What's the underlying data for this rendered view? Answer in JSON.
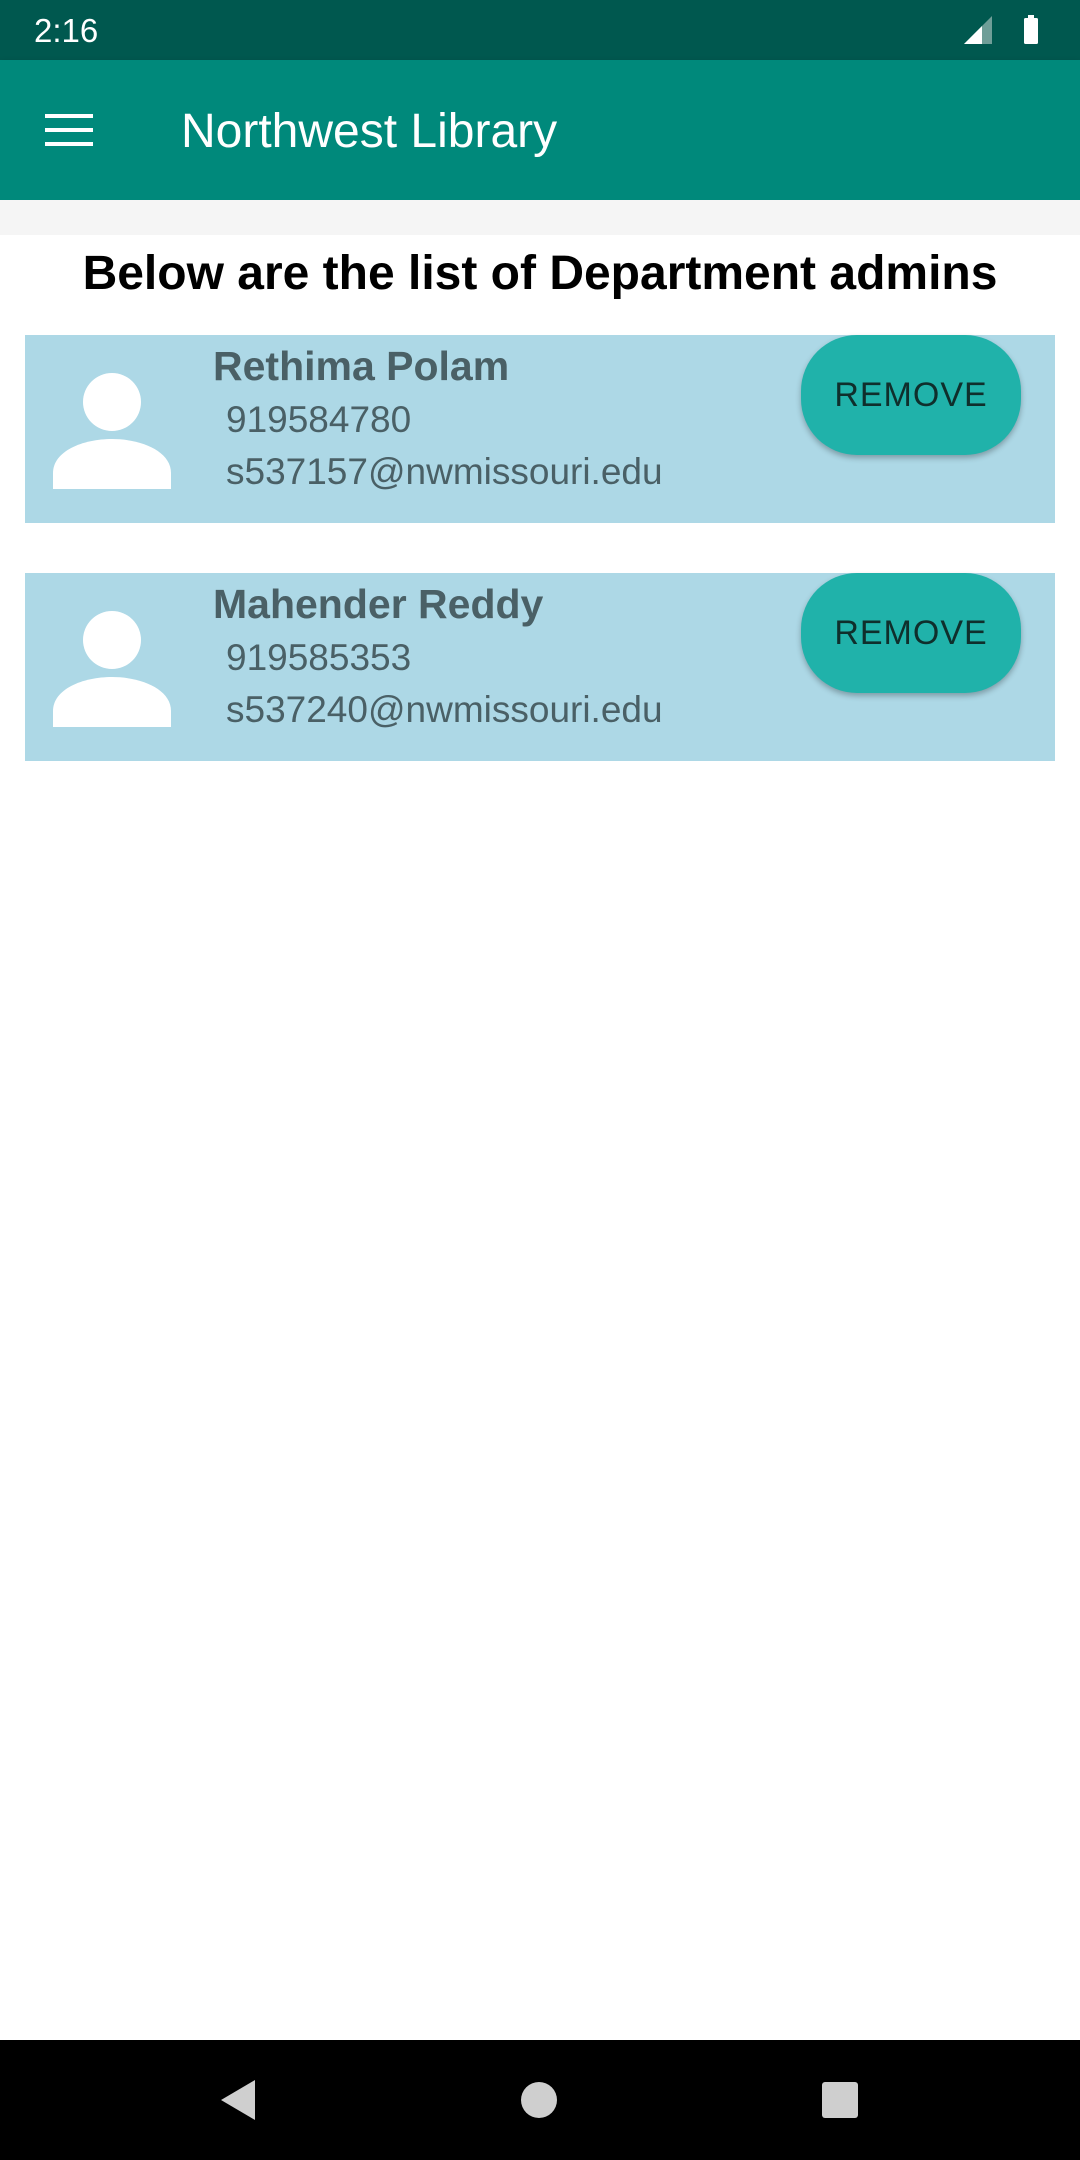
{
  "status_bar": {
    "time": "2:16",
    "icons": [
      "signal-icon",
      "battery-icon"
    ]
  },
  "app_bar": {
    "title": "Northwest Library",
    "menu_icon": "menu-icon"
  },
  "page": {
    "heading": "Below are the list of Department admins"
  },
  "admins": [
    {
      "name": "Rethima Polam",
      "phone": "919584780",
      "email": "s537157@nwmissouri.edu",
      "action_label": "REMOVE"
    },
    {
      "name": "Mahender Reddy",
      "phone": "919585353",
      "email": "s537240@nwmissouri.edu",
      "action_label": "REMOVE"
    }
  ],
  "nav_bar": {
    "buttons": [
      "back-icon",
      "home-icon",
      "recents-icon"
    ]
  },
  "colors": {
    "status_bar": "#00584F",
    "app_bar": "#00897B",
    "card_background": "#ADD8E6",
    "remove_button": "#20B2AA",
    "card_text": "#4a6066"
  }
}
